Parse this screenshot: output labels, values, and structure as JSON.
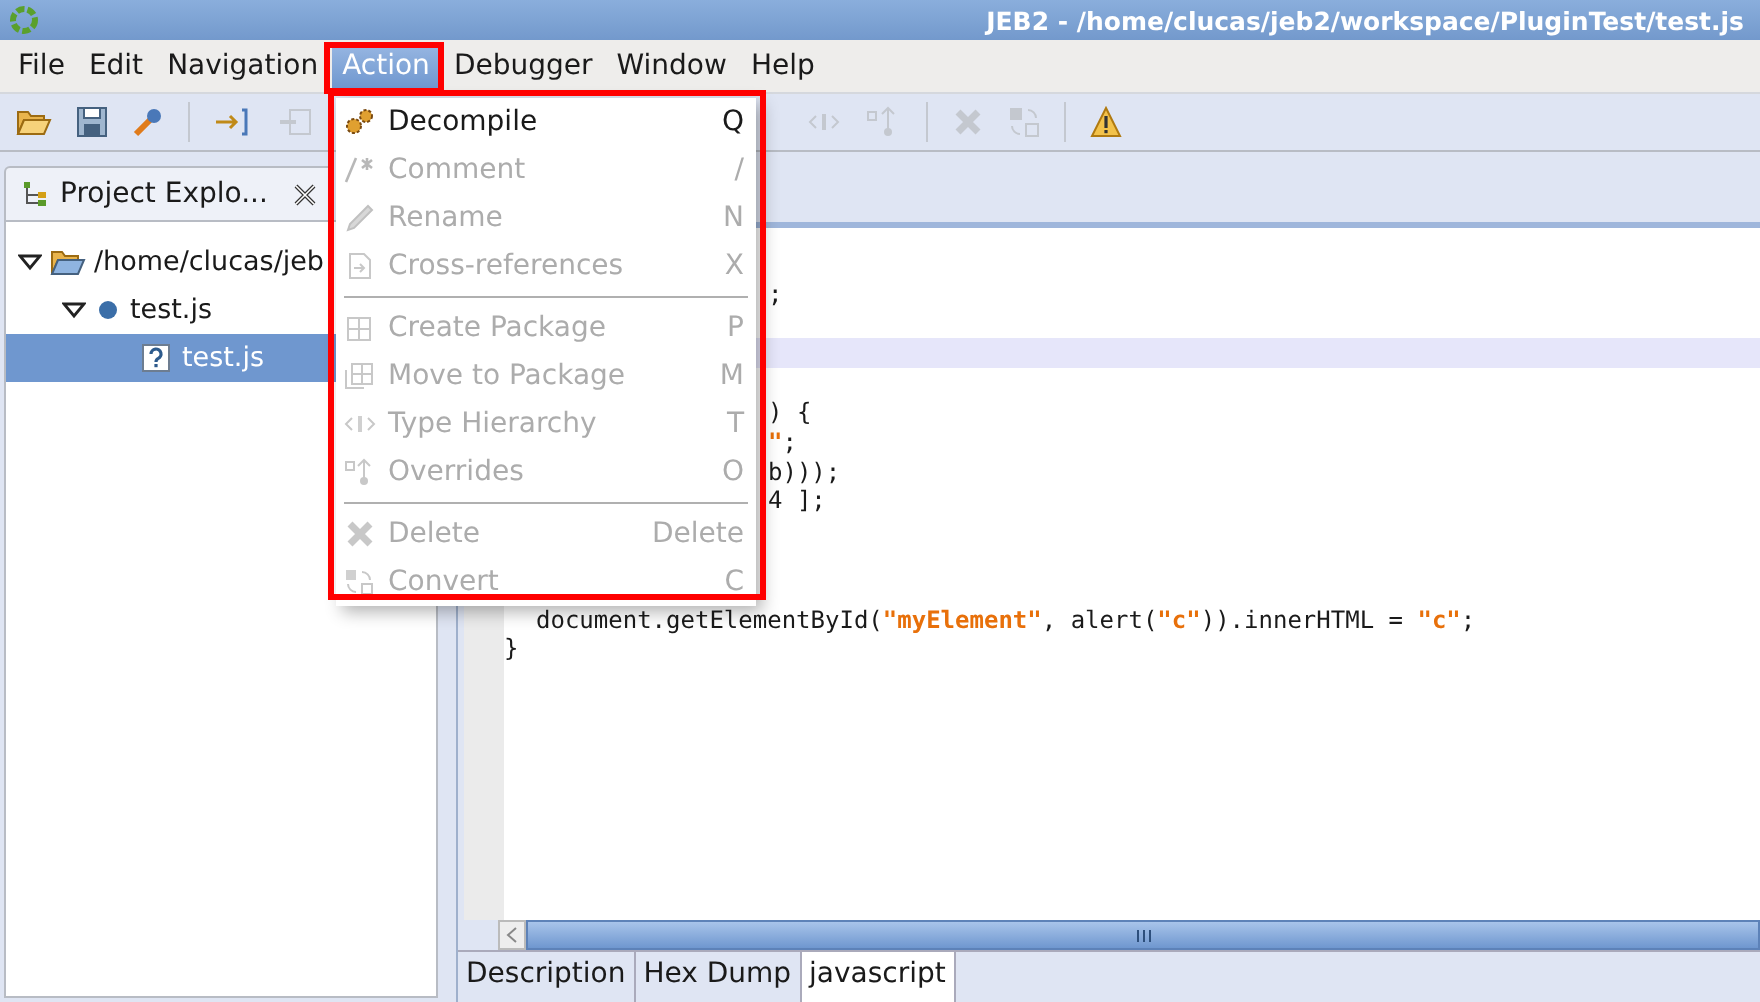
{
  "window": {
    "title": "JEB2 - /home/clucas/jeb2/workspace/PluginTest/test.js"
  },
  "menu_bar": [
    {
      "label": "File",
      "selected": false
    },
    {
      "label": "Edit",
      "selected": false
    },
    {
      "label": "Navigation",
      "selected": false
    },
    {
      "label": "Action",
      "selected": true
    },
    {
      "label": "Debugger",
      "selected": false
    },
    {
      "label": "Window",
      "selected": false
    },
    {
      "label": "Help",
      "selected": false
    }
  ],
  "action_menu": {
    "groups": [
      [
        {
          "label": "Decompile",
          "shortcut": "Q",
          "disabled": false
        },
        {
          "label": "Comment",
          "shortcut": "/",
          "disabled": true
        },
        {
          "label": "Rename",
          "shortcut": "N",
          "disabled": true
        },
        {
          "label": "Cross-references",
          "shortcut": "X",
          "disabled": true
        }
      ],
      [
        {
          "label": "Create Package",
          "shortcut": "P",
          "disabled": true
        },
        {
          "label": "Move to Package",
          "shortcut": "M",
          "disabled": true
        },
        {
          "label": "Type Hierarchy",
          "shortcut": "T",
          "disabled": true
        },
        {
          "label": "Overrides",
          "shortcut": "O",
          "disabled": true
        }
      ],
      [
        {
          "label": "Delete",
          "shortcut": "Delete",
          "disabled": true
        },
        {
          "label": "Convert",
          "shortcut": "C",
          "disabled": true
        }
      ]
    ]
  },
  "project_explorer": {
    "title": "Project Explo...",
    "tree": [
      {
        "label": "/home/clucas/jeb",
        "expanded": true,
        "selected": false,
        "children": [
          {
            "label": "test.js",
            "expanded": true,
            "selected": false,
            "children": [
              {
                "label": "test.js",
                "selected": true
              }
            ]
          }
        ]
      }
    ]
  },
  "editor": {
    "lines": [
      {
        "kind": "blank",
        "highlighted": false
      },
      {
        "kind": "partial",
        "highlighted": false,
        "segments": [
          {
            "kind": "plain",
            "text": ";"
          }
        ]
      },
      {
        "kind": "blank",
        "highlighted": false
      },
      {
        "kind": "blank",
        "highlighted": true
      },
      {
        "kind": "blank",
        "highlighted": false
      },
      {
        "kind": "partial",
        "highlighted": false,
        "segments": [
          {
            "kind": "plain",
            "text": ") {"
          }
        ]
      },
      {
        "kind": "partial",
        "highlighted": false,
        "segments": [
          {
            "kind": "string",
            "text": "\""
          },
          {
            "kind": "plain",
            "text": ";"
          }
        ]
      },
      {
        "kind": "partial",
        "highlighted": false,
        "segments": [
          {
            "kind": "plain",
            "text": "b)));"
          }
        ]
      },
      {
        "kind": "partial",
        "highlighted": false,
        "segments": [
          {
            "kind": "plain",
            "text": "4 ];"
          }
        ]
      },
      {
        "kind": "blank",
        "highlighted": false
      },
      {
        "kind": "blank",
        "highlighted": false
      },
      {
        "kind": "blank",
        "highlighted": false
      },
      {
        "kind": "indent",
        "highlighted": false,
        "segments": [
          {
            "kind": "plain",
            "text": "document.getElementById("
          },
          {
            "kind": "string",
            "text": "\"myElement\""
          },
          {
            "kind": "plain",
            "text": ", alert("
          },
          {
            "kind": "string",
            "text": "\"c\""
          },
          {
            "kind": "plain",
            "text": ")).innerHTML = "
          },
          {
            "kind": "string",
            "text": "\"c\""
          },
          {
            "kind": "plain",
            "text": ";"
          }
        ]
      },
      {
        "kind": "full",
        "highlighted": false,
        "segments": [
          {
            "kind": "plain",
            "text": "}"
          }
        ]
      }
    ],
    "bottom_tabs": [
      {
        "label": "Description",
        "selected": false
      },
      {
        "label": "Hex Dump",
        "selected": false
      },
      {
        "label": "javascript",
        "selected": true
      }
    ]
  }
}
